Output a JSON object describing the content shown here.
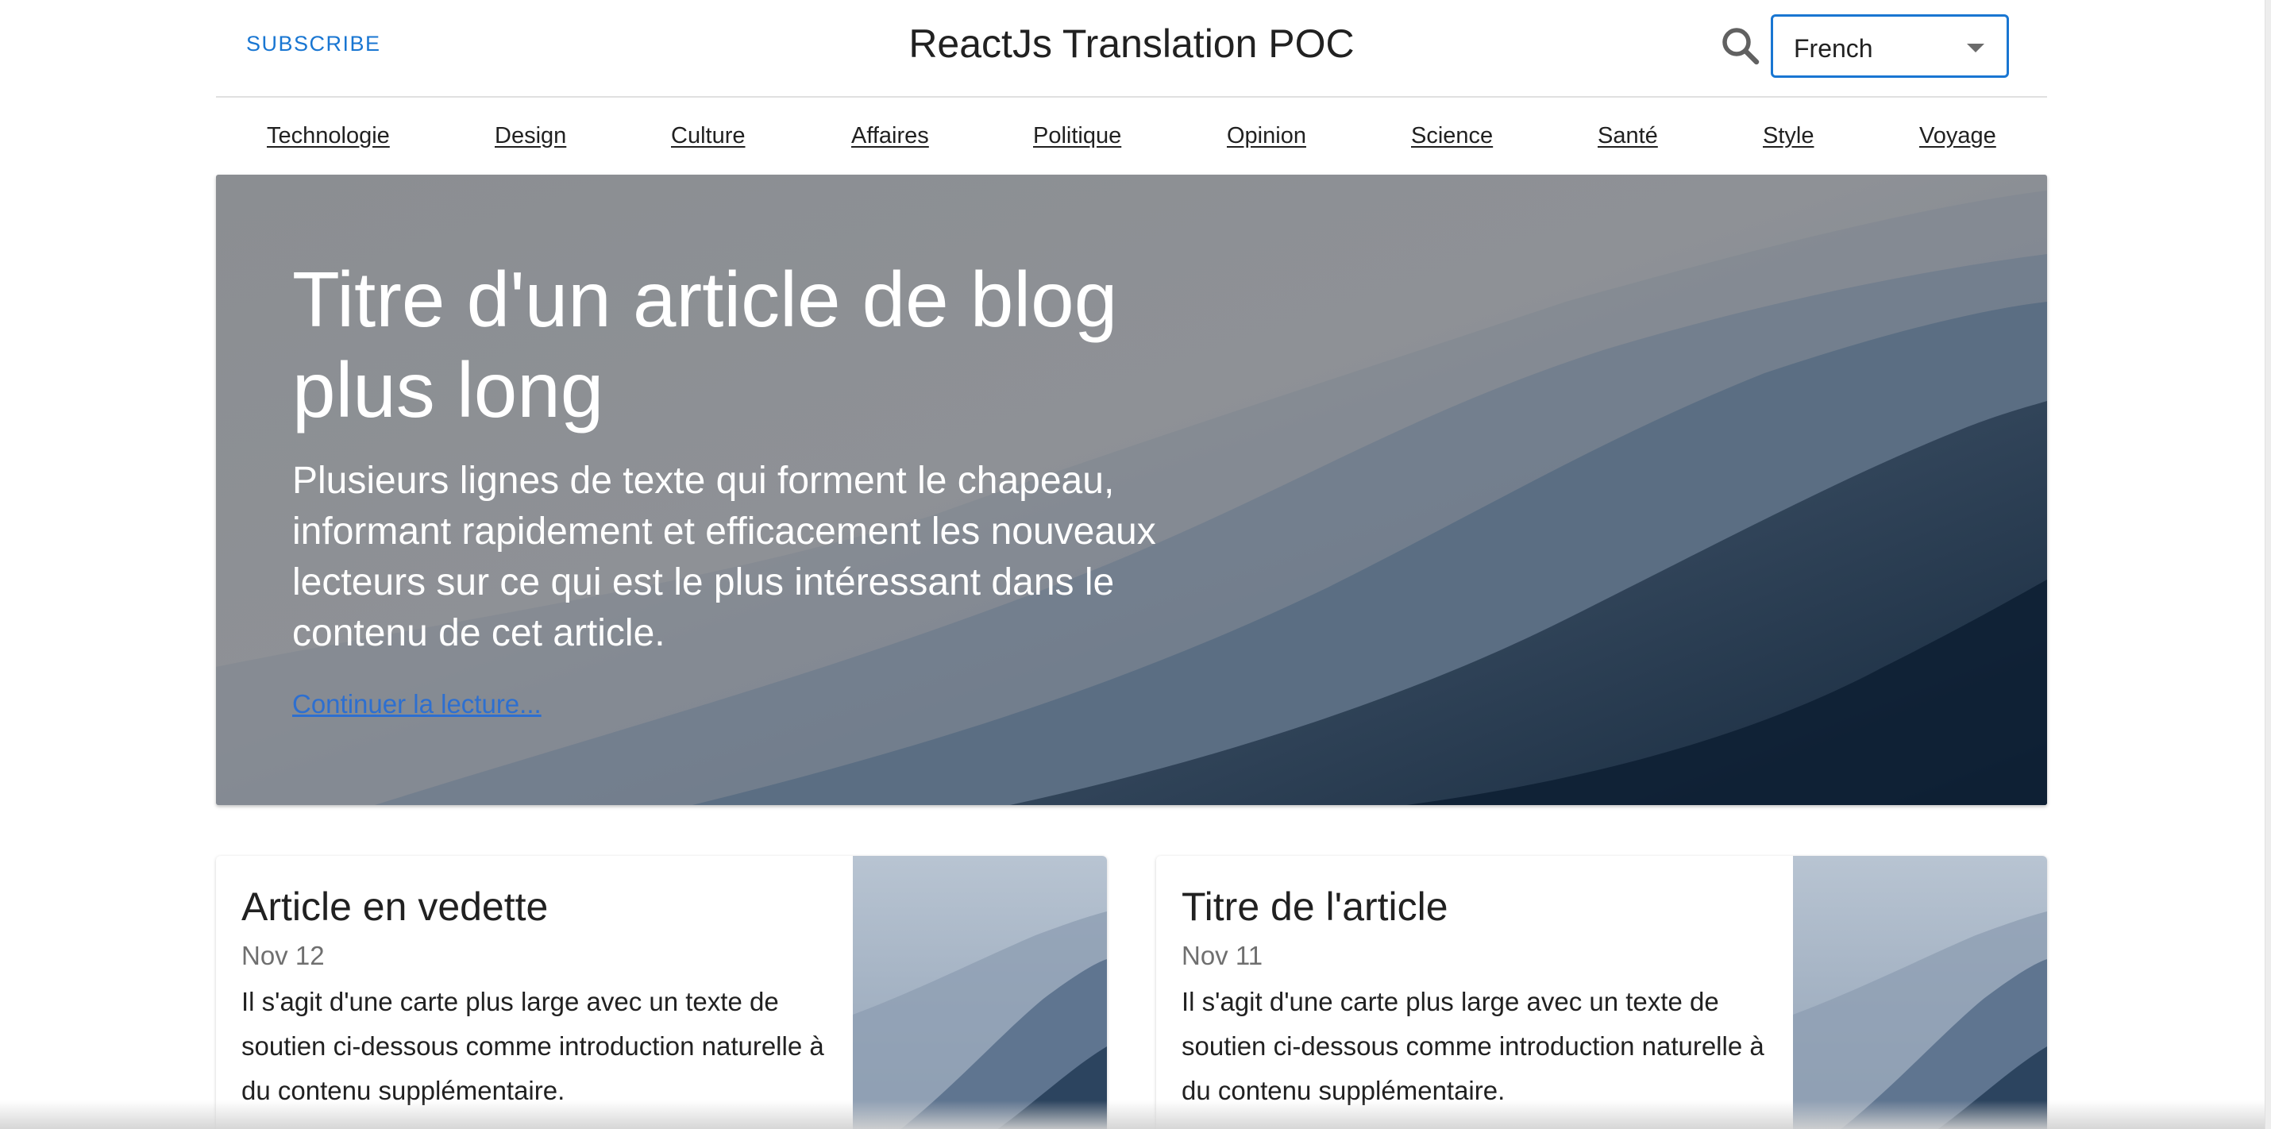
{
  "header": {
    "subscribe_label": "SUBSCRIBE",
    "title": "ReactJs Translation POC",
    "language_selected": "French"
  },
  "nav": {
    "items": [
      "Technologie",
      "Design",
      "Culture",
      "Affaires",
      "Politique",
      "Opinion",
      "Science",
      "Santé",
      "Style",
      "Voyage"
    ]
  },
  "hero": {
    "title": "Titre d'un article de blog plus long",
    "text": "Plusieurs lignes de texte qui forment le chapeau, informant rapidement et efficacement les nouveaux lecteurs sur ce qui est le plus intéressant dans le contenu de cet article.",
    "link": "Continuer la lecture..."
  },
  "cards": [
    {
      "title": "Article en vedette",
      "date": "Nov 12",
      "description": "Il s'agit d'une carte plus large avec un texte de soutien ci-dessous comme introduction naturelle à du contenu supplémentaire."
    },
    {
      "title": "Titre de l'article",
      "date": "Nov 11",
      "description": "Il s'agit d'une carte plus large avec un texte de soutien ci-dessous comme introduction naturelle à du contenu supplémentaire."
    }
  ],
  "icons": {
    "search": "search-icon",
    "dropdown": "chevron-down-icon"
  },
  "colors": {
    "accent": "#1976d2",
    "link": "#2d6fd0"
  }
}
